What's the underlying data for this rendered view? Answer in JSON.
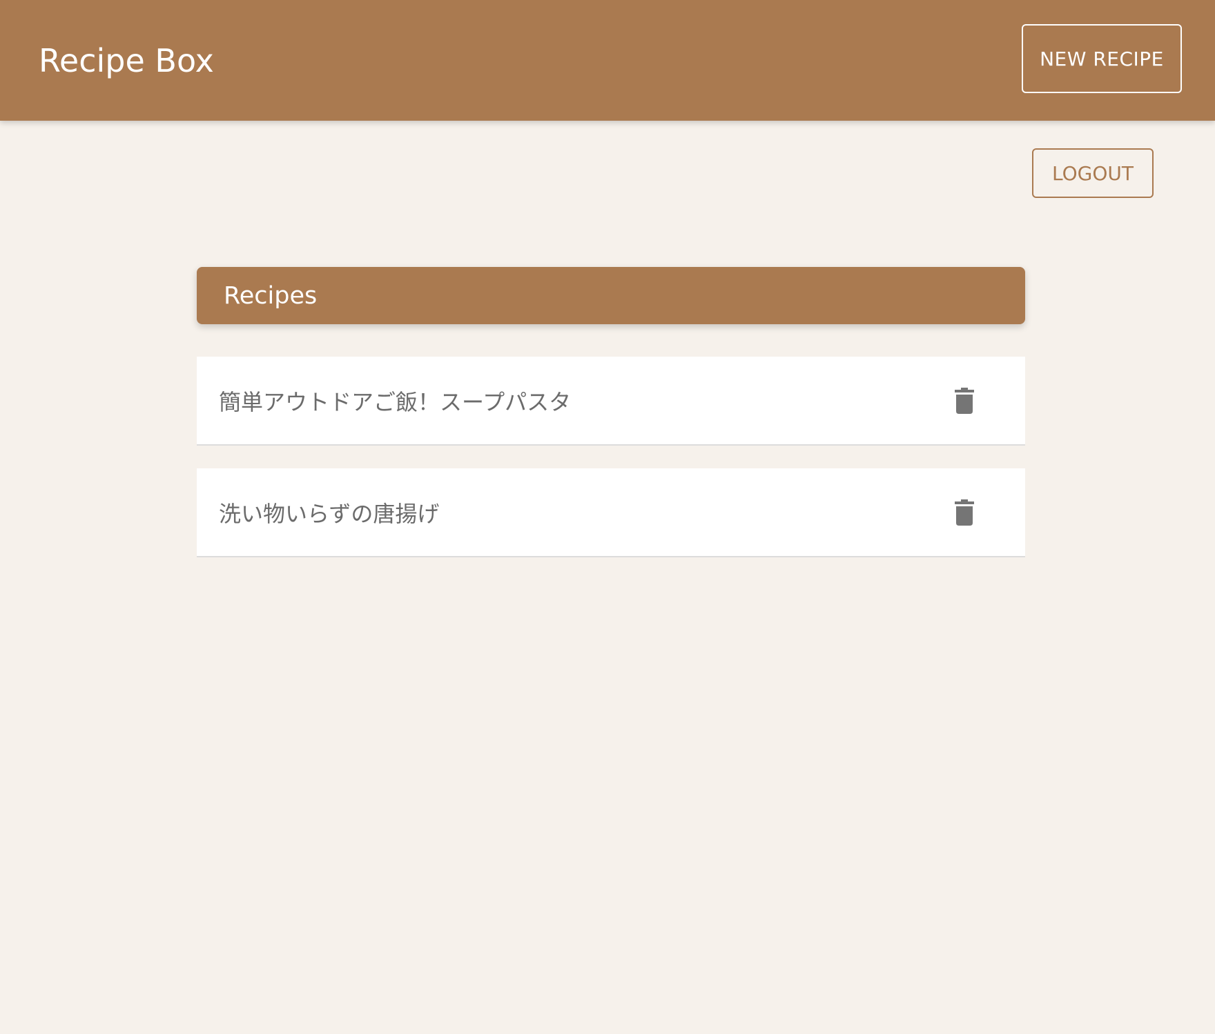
{
  "app_bar": {
    "title": "Recipe Box",
    "new_recipe_label": "NEW RECIPE"
  },
  "account": {
    "logout_label": "LOGOUT"
  },
  "recipes_panel": {
    "title": "Recipes",
    "items": [
      {
        "name": "簡単アウトドアご飯！スープパスタ",
        "action_icon": "trash-icon"
      },
      {
        "name": "洗い物いらずの唐揚げ",
        "action_icon": "trash-icon"
      }
    ]
  },
  "colors": {
    "brand": "#aa7a50",
    "background": "#f6f1eb",
    "card": "#ffffff",
    "item_text": "#6b6b6b",
    "icon": "#757575"
  }
}
